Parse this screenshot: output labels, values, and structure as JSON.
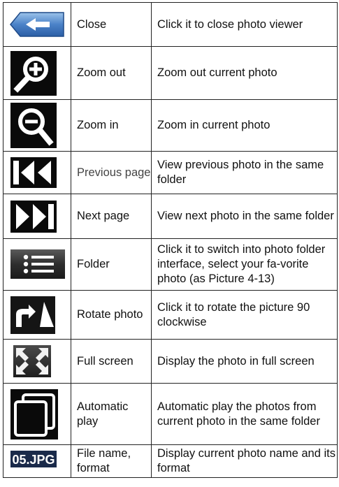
{
  "rows": [
    {
      "icon": "back-arrow-icon",
      "name": "Close",
      "desc": "Click it to close photo viewer"
    },
    {
      "icon": "zoom-plus-icon",
      "name": "Zoom out",
      "desc": "Zoom out current photo"
    },
    {
      "icon": "zoom-minus-icon",
      "name": "Zoom in",
      "desc": "Zoom in current photo"
    },
    {
      "icon": "previous-page-icon",
      "name": "Previous page",
      "desc": "View previous photo in the same folder"
    },
    {
      "icon": "next-page-icon",
      "name": "Next  page",
      "desc": "View next photo in the same folder"
    },
    {
      "icon": "folder-list-icon",
      "name": "Folder",
      "desc": "Click it to switch into photo folder interface, select your fa-vorite photo (as Picture 4-13)"
    },
    {
      "icon": "rotate-icon",
      "name": "Rotate photo",
      "desc": "Click it to rotate the picture 90 clockwise"
    },
    {
      "icon": "full-screen-icon",
      "name": "Full screen",
      "desc": "Display the photo in full screen"
    },
    {
      "icon": "automatic-play-icon",
      "name": "Automatic play",
      "desc": "Automatic play the photos from current photo in the same folder"
    },
    {
      "icon": "file-name-label",
      "label": "05.JPG",
      "name": "File name, format",
      "desc": "Display current photo name and its format"
    }
  ],
  "colors": {
    "border": "#222222",
    "icon_dark": "#0a0a0a",
    "back_button_blue": "#3a6fb8",
    "file_label_bg": "#1a2a4a"
  }
}
